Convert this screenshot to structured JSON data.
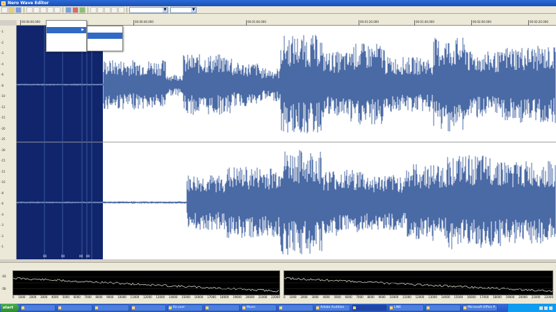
{
  "window": {
    "title": "Nero Wave Editor"
  },
  "toolbar": {
    "track_select": "",
    "zoom_select": ""
  },
  "menubar": {
    "items": [
      "",
      "",
      "",
      "",
      "",
      "",
      "",
      "",
      "",
      "",
      "",
      ""
    ]
  },
  "menu_open": {
    "dropdown1": [
      "",
      "",
      "",
      ""
    ],
    "dropdown2": [
      "",
      "",
      "",
      ""
    ]
  },
  "ruler": {
    "times": [
      "00:00:00.000",
      "00:00:40.000",
      "00:01:00.000",
      "00:01:20.000",
      "00:01:40.000",
      "00:02:00.000",
      "00:02:20.000",
      "00:02:40.000"
    ]
  },
  "db_scale": [
    "-1",
    "-2",
    "-3",
    "-4",
    "-6",
    "-8",
    "-10",
    "-12",
    "-15",
    "-20",
    "-25",
    "-30",
    "-15",
    "-12",
    "-10",
    "-8",
    "-6",
    "-4",
    "-3",
    "-2",
    "-1"
  ],
  "markers": [
    "00",
    "00",
    "00",
    "00"
  ],
  "spectrum": {
    "panel_title": "",
    "left_label": "",
    "right_label": "",
    "freq_ticks": [
      "0",
      "1000",
      "2000",
      "3000",
      "4000",
      "5000",
      "6000",
      "7000",
      "8000",
      "9000",
      "10000",
      "11000",
      "12000",
      "13000",
      "14000",
      "15000",
      "16000",
      "17000",
      "18000",
      "19000",
      "20000",
      "21000",
      "22000"
    ],
    "y_ticks": [
      "-10",
      "-50"
    ],
    "status": ""
  },
  "taskbar": {
    "start": "start",
    "tasks": [
      "",
      "",
      "",
      "",
      "Rz.uver",
      "",
      "Music",
      "",
      "Adobe Audition",
      "",
      "LINE",
      "",
      "Microsoft Office P..."
    ],
    "active_index": 9,
    "clock": ""
  },
  "colors": {
    "selection": "#10256b",
    "waveform": "#4a6aa5",
    "waveform_selected": "#8aa0d0",
    "menu_highlight": "#316ac5"
  }
}
